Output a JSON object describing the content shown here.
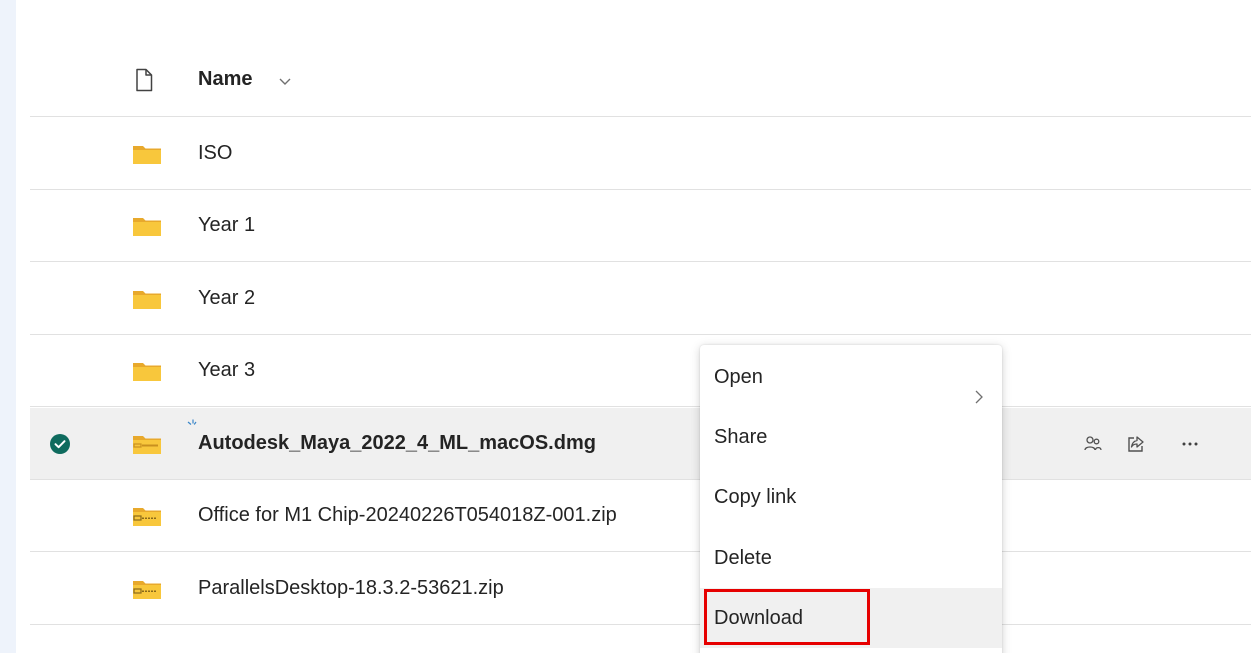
{
  "colors": {
    "folder": "#f8c73c",
    "folder_dark": "#e8a92c",
    "check": "#0f6b5e",
    "selected_row": "#f0f0f0",
    "highlight": "#e60000",
    "archive_stripe": "#c9901f"
  },
  "list": {
    "header": {
      "name_label": "Name",
      "file_icon": "document-icon",
      "sort_icon": "chevron-down-icon"
    },
    "rows": [
      {
        "name": "ISO",
        "type": "folder",
        "icon": "folder-icon"
      },
      {
        "name": "Year 1",
        "type": "folder",
        "icon": "folder-icon"
      },
      {
        "name": "Year 2",
        "type": "folder",
        "icon": "folder-icon"
      },
      {
        "name": "Year 3",
        "type": "folder",
        "icon": "folder-icon"
      },
      {
        "name": "Autodesk_Maya_2022_4_ML_macOS.dmg",
        "type": "file",
        "icon": "disk-image-icon",
        "selected": true,
        "new_icon": "new-item-icon"
      },
      {
        "name": "Office for M1 Chip-20240226T054018Z-001.zip",
        "type": "archive",
        "icon": "zip-folder-icon"
      },
      {
        "name": "ParallelsDesktop-18.3.2-53621.zip",
        "type": "archive",
        "icon": "zip-folder-icon"
      }
    ],
    "selected_row_actions": [
      {
        "icon": "manage-access-icon"
      },
      {
        "icon": "share-icon"
      },
      {
        "icon": "more-options-icon"
      }
    ]
  },
  "context_menu": {
    "items": [
      {
        "label": "Open",
        "has_submenu": true
      },
      {
        "label": "Share"
      },
      {
        "label": "Copy link"
      },
      {
        "label": "Delete"
      },
      {
        "label": "Download",
        "highlighted": true
      }
    ]
  }
}
